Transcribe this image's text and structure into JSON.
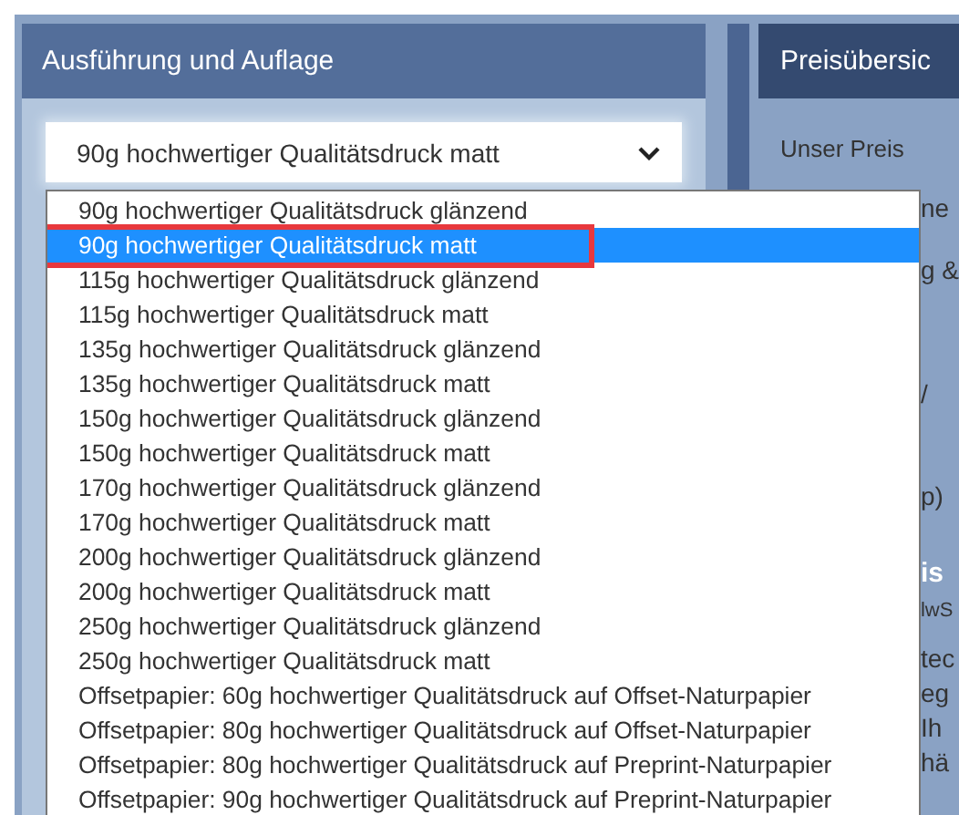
{
  "left_panel": {
    "title": "Ausführung und Auflage",
    "select": {
      "value": "90g hochwertiger Qualitätsdruck matt",
      "expanded": true
    }
  },
  "dropdown": {
    "options": [
      {
        "label": "90g hochwertiger Qualitätsdruck glänzend",
        "selected": false,
        "highlighted": false
      },
      {
        "label": "90g hochwertiger Qualitätsdruck matt",
        "selected": true,
        "highlighted": true
      },
      {
        "label": "115g hochwertiger Qualitätsdruck glänzend",
        "selected": false,
        "highlighted": false
      },
      {
        "label": "115g hochwertiger Qualitätsdruck matt",
        "selected": false,
        "highlighted": false
      },
      {
        "label": "135g hochwertiger Qualitätsdruck glänzend",
        "selected": false,
        "highlighted": false
      },
      {
        "label": "135g hochwertiger Qualitätsdruck matt",
        "selected": false,
        "highlighted": false
      },
      {
        "label": "150g hochwertiger Qualitätsdruck glänzend",
        "selected": false,
        "highlighted": false
      },
      {
        "label": "150g hochwertiger Qualitätsdruck matt",
        "selected": false,
        "highlighted": false
      },
      {
        "label": "170g hochwertiger Qualitätsdruck glänzend",
        "selected": false,
        "highlighted": false
      },
      {
        "label": "170g hochwertiger Qualitätsdruck matt",
        "selected": false,
        "highlighted": false
      },
      {
        "label": "200g hochwertiger Qualitätsdruck glänzend",
        "selected": false,
        "highlighted": false
      },
      {
        "label": "200g hochwertiger Qualitätsdruck matt",
        "selected": false,
        "highlighted": false
      },
      {
        "label": "250g hochwertiger Qualitätsdruck glänzend",
        "selected": false,
        "highlighted": false
      },
      {
        "label": "250g hochwertiger Qualitätsdruck matt",
        "selected": false,
        "highlighted": false
      },
      {
        "label": "Offsetpapier: 60g hochwertiger Qualitätsdruck auf Offset-Naturpapier",
        "selected": false,
        "highlighted": false
      },
      {
        "label": "Offsetpapier: 80g hochwertiger Qualitätsdruck auf Offset-Naturpapier",
        "selected": false,
        "highlighted": false
      },
      {
        "label": "Offsetpapier: 80g hochwertiger Qualitätsdruck auf Preprint-Naturpapier",
        "selected": false,
        "highlighted": false
      },
      {
        "label": "Offsetpapier: 90g hochwertiger Qualitätsdruck auf Preprint-Naturpapier",
        "selected": false,
        "highlighted": false
      }
    ]
  },
  "right_panel": {
    "title": "Preisübersic",
    "label": "Unser Preis",
    "fragments": [
      {
        "kind": "text",
        "text": "ne"
      },
      {
        "kind": "text",
        "text": "g &"
      },
      {
        "kind": "text",
        "text": "/"
      },
      {
        "kind": "text",
        "text": "p)"
      },
      {
        "kind": "heading",
        "text": "is"
      },
      {
        "kind": "small",
        "text": "lwS"
      },
      {
        "kind": "text",
        "text": "tec"
      },
      {
        "kind": "text",
        "text": "eg"
      },
      {
        "kind": "text",
        "text": "Ih"
      },
      {
        "kind": "text",
        "text": "hä"
      }
    ]
  }
}
